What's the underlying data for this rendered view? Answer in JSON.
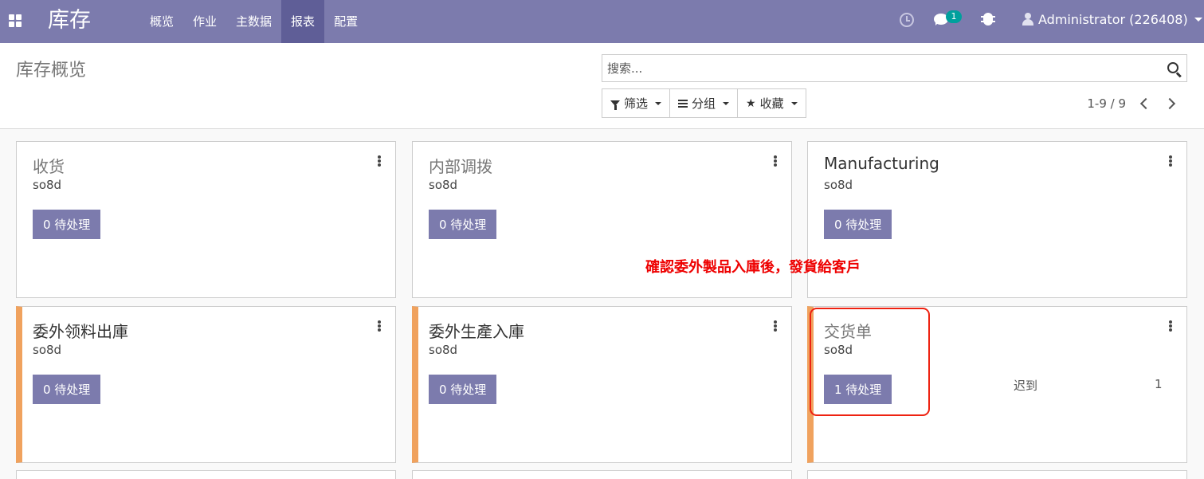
{
  "navbar": {
    "app_name": "库存",
    "menu": [
      "概览",
      "作业",
      "主数据",
      "报表",
      "配置"
    ],
    "active_menu": "报表",
    "chat_count": "1",
    "user": "Administrator (226408)"
  },
  "control_panel": {
    "title": "库存概览",
    "search_placeholder": "搜索...",
    "filter_label": "筛选",
    "group_label": "分组",
    "favorites_label": "收藏",
    "pager": "1-9 / 9"
  },
  "cards": [
    {
      "title": "收货",
      "company": "so8d",
      "button": "0 待处理"
    },
    {
      "title": "内部调拨",
      "company": "so8d",
      "button": "0 待处理"
    },
    {
      "title": "Manufacturing",
      "company": "so8d",
      "button": "0 待处理"
    },
    {
      "title": "委外领料出庫",
      "company": "so8d",
      "button": "0 待处理"
    },
    {
      "title": "委外生產入庫",
      "company": "so8d",
      "button": "0 待处理"
    },
    {
      "title": "交货单",
      "company": "so8d",
      "button": "1 待处理",
      "late_label": "迟到",
      "late_count": "1"
    }
  ],
  "annotation": "確認委外製品入庫後，發貨給客戶",
  "colors": {
    "navbar": "#7c7bad",
    "accent_late": "#f0a25e",
    "annotation": "#e00000"
  }
}
